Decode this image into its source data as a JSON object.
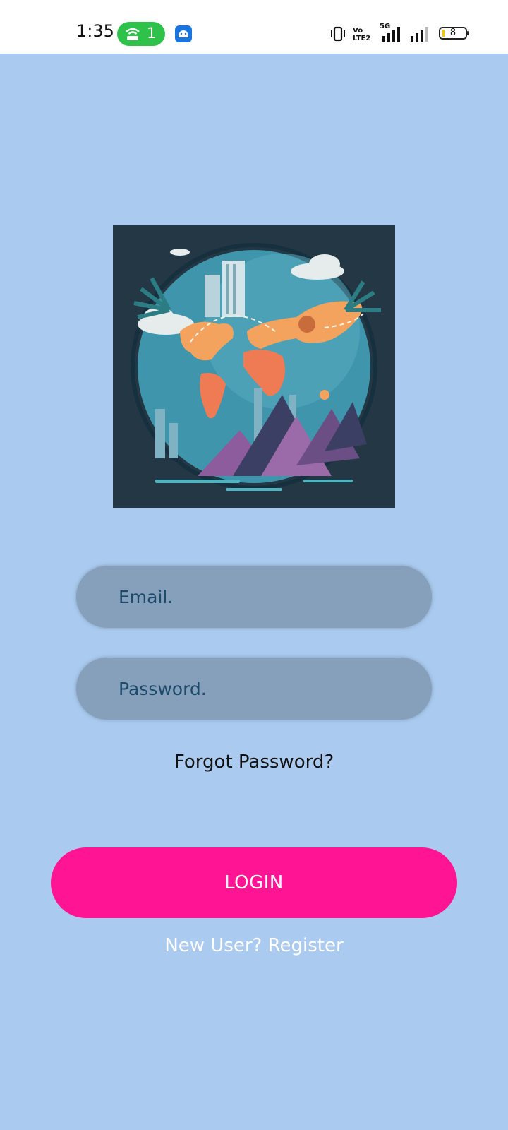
{
  "status_bar": {
    "time": "1:35",
    "hotspot_count": "1",
    "network_type": "5G",
    "volte_label": "Vo LTE2",
    "battery_level": "8"
  },
  "login_form": {
    "email_placeholder": "Email.",
    "password_placeholder": "Password.",
    "forgot_password": "Forgot Password?",
    "login_button": "LOGIN",
    "register_link": "New User? Register"
  },
  "colors": {
    "background": "#aacbef",
    "accent": "#ff1493",
    "field_bg": "#869fbb"
  }
}
